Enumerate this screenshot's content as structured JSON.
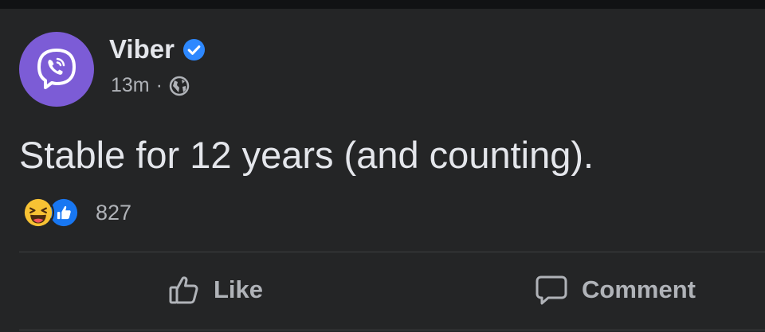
{
  "post": {
    "author": "Viber",
    "time": "13m",
    "separator": "·",
    "text": "Stable for 12 years (and counting).",
    "reaction_count": "827"
  },
  "actions": {
    "like_label": "Like",
    "comment_label": "Comment"
  },
  "icons": [
    "viber-logo-icon",
    "verified-badge-icon",
    "globe-icon",
    "haha-reaction-icon",
    "like-reaction-icon",
    "like-icon",
    "comment-icon"
  ],
  "colors": {
    "background": "#242526",
    "viber_purple": "#7c5cd6",
    "verified_blue": "#2d88ff",
    "secondary_text": "#b0b3b8"
  }
}
